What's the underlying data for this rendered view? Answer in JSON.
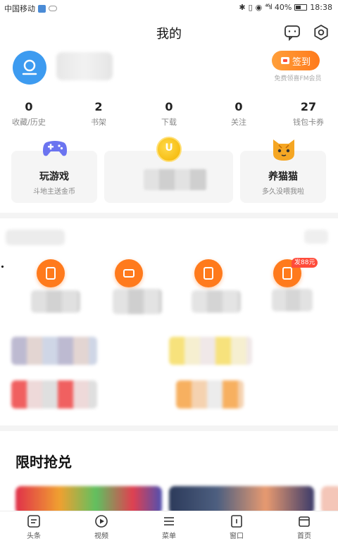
{
  "status_bar": {
    "carrier": "中国移动",
    "signal": "⁴⁶ıl",
    "battery": "40%",
    "time": "18:38"
  },
  "header": {
    "title": "我的"
  },
  "profile": {
    "sign_in_label": "签到",
    "sign_in_note": "免费领喜FM会员"
  },
  "stats": [
    {
      "value": "0",
      "label": "收藏/历史"
    },
    {
      "value": "2",
      "label": "书架"
    },
    {
      "value": "0",
      "label": "下载"
    },
    {
      "value": "0",
      "label": "关注"
    },
    {
      "value": "27",
      "label": "钱包卡券"
    }
  ],
  "feature_cards": [
    {
      "title": "玩游戏",
      "subtitle": "斗地主送金币",
      "icon": "gamepad-icon"
    },
    {
      "title": "",
      "subtitle": "",
      "icon": "coin-icon"
    },
    {
      "title": "养猫猫",
      "subtitle": "多久没喂我啦",
      "icon": "cat-icon"
    }
  ],
  "tools": {
    "badge_text": "发88元"
  },
  "section": {
    "title": "限时抢兑"
  },
  "tabbar": [
    {
      "label": "头条",
      "icon": "news-icon"
    },
    {
      "label": "视频",
      "icon": "play-icon"
    },
    {
      "label": "菜单",
      "icon": "menu-icon"
    },
    {
      "label": "窗口",
      "icon": "window-icon"
    },
    {
      "label": "首页",
      "icon": "home-icon"
    }
  ],
  "colors": {
    "accent": "#ff7a1c",
    "avatar": "#3d9bf0",
    "badge": "#ff4b3a"
  }
}
